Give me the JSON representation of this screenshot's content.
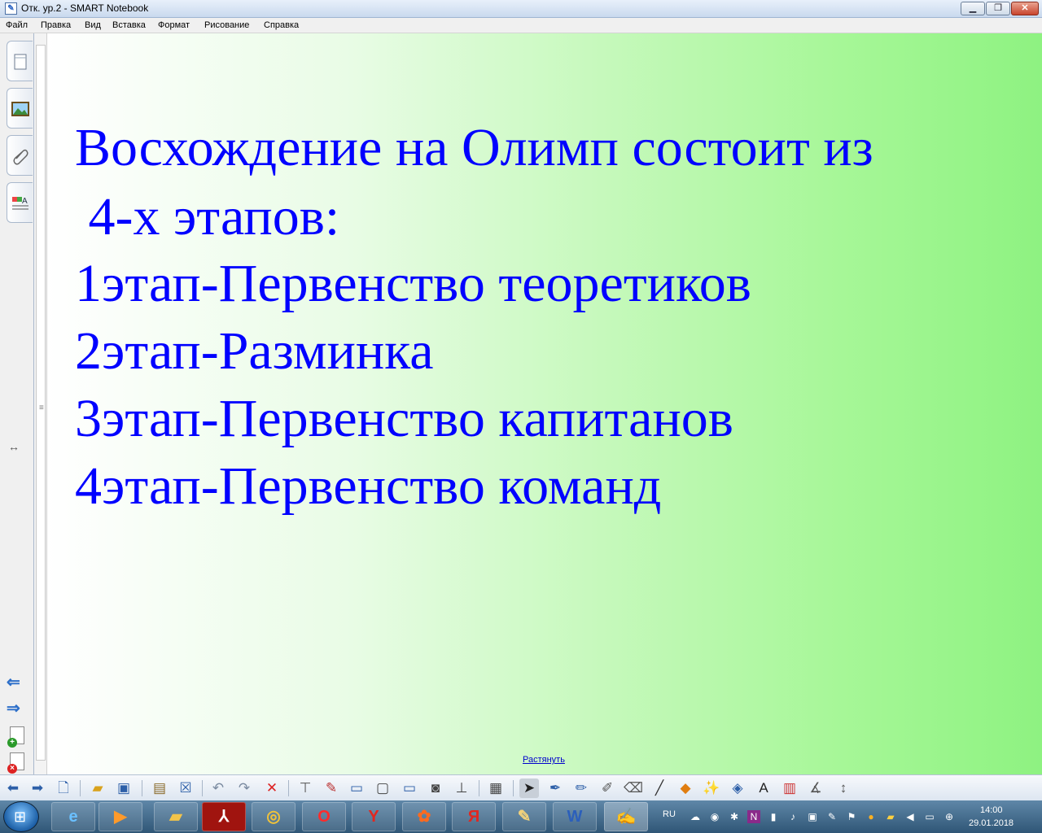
{
  "window": {
    "title": "Отк. ур.2 - SMART Notebook",
    "minimize_label": "▁",
    "maximize_label": "❐",
    "close_label": "✕"
  },
  "menu": [
    "Файл",
    "Правка",
    "Вид",
    "Вставка",
    "Формат",
    "Рисование",
    "Справка"
  ],
  "sidebar": {
    "tabs": [
      "page-sorter-icon",
      "gallery-icon",
      "attachments-icon",
      "properties-icon"
    ],
    "resize_glyph": "↔",
    "prev_glyph": "⇐",
    "next_glyph": "⇒"
  },
  "slide": {
    "lines": [
      "Восхождение на Олимп состоит из",
      " 4-х этапов:",
      "1этап-Первенство теоретиков",
      "2этап-Разминка",
      "3этап-Первенство капитанов",
      "4этап-Первенство команд"
    ],
    "text_color": "#0000ff",
    "stretch_link": "Растянуть"
  },
  "toolbar": {
    "icons": [
      "back-icon",
      "forward-icon",
      "add-page-icon",
      "open-icon",
      "save-icon",
      "paste-icon",
      "delete-page-icon",
      "undo-icon",
      "redo-icon",
      "delete-icon",
      "screen-shade-icon",
      "show-hide-icon",
      "display-icon",
      "screen-capture-icon",
      "capture-icon",
      "document-camera-icon",
      "table-icon",
      "select-icon",
      "pen-icon",
      "creative-pen-icon",
      "highlighter-icon",
      "eraser-icon",
      "line-icon",
      "shapes-icon",
      "magic-pen-icon",
      "fill-icon",
      "text-icon",
      "properties-icon",
      "measure-icon",
      "move-toolbar-icon"
    ]
  },
  "taskbar": {
    "apps": [
      "ie-icon",
      "media-icon",
      "explorer-icon",
      "pdf-icon",
      "chrome-icon",
      "opera-icon",
      "yandex-browser-icon",
      "media-player-icon",
      "yandex-icon",
      "notebook-app-icon",
      "word-icon",
      "smart-notebook-icon"
    ],
    "lang": "RU",
    "time": "14:00",
    "date": "29.01.2018"
  }
}
